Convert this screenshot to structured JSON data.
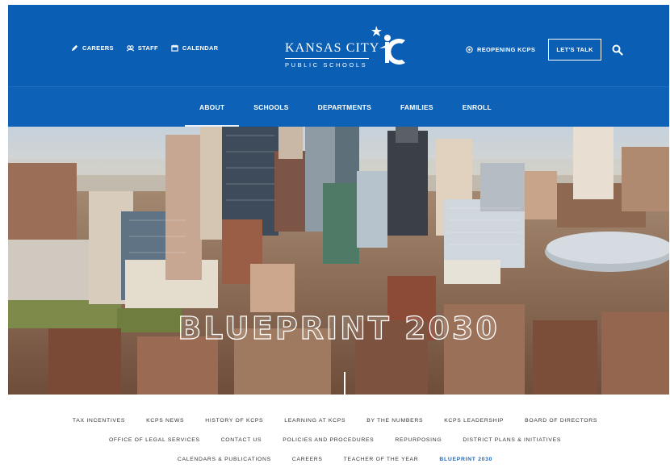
{
  "header": {
    "util_left": [
      {
        "label": "CAREERS",
        "icon": "pencil-icon"
      },
      {
        "label": "STAFF",
        "icon": "staff-icon"
      },
      {
        "label": "CALENDAR",
        "icon": "calendar-icon"
      }
    ],
    "logo": {
      "line1": "KANSAS CITY",
      "line2": "PUBLIC SCHOOLS"
    },
    "reopening_label": "REOPENING KCPS",
    "lets_talk_label": "LET'S TALK",
    "colors": {
      "header_blue": "#0a5fb4",
      "nav_blue": "#0d62b8",
      "accent_link": "#1f67b8"
    }
  },
  "main_nav": [
    {
      "label": "ABOUT",
      "active": true
    },
    {
      "label": "SCHOOLS",
      "active": false
    },
    {
      "label": "DEPARTMENTS",
      "active": false
    },
    {
      "label": "FAMILIES",
      "active": false
    },
    {
      "label": "ENROLL",
      "active": false
    }
  ],
  "hero": {
    "title": "BLUEPRINT 2030"
  },
  "sub_nav": {
    "row1": [
      "TAX INCENTIVES",
      "KCPS NEWS",
      "HISTORY OF KCPS",
      "LEARNING AT KCPS",
      "BY THE NUMBERS",
      "KCPS LEADERSHIP",
      "BOARD OF DIRECTORS"
    ],
    "row2": [
      "OFFICE OF LEGAL SERVICES",
      "CONTACT US",
      "POLICIES AND PROCEDURES",
      "REPURPOSING",
      "DISTRICT PLANS & INITIATIVES"
    ],
    "row3": [
      "CALENDARS & PUBLICATIONS",
      "CAREERS",
      "TEACHER OF THE YEAR",
      "BLUEPRINT 2030"
    ],
    "current": "BLUEPRINT 2030"
  }
}
